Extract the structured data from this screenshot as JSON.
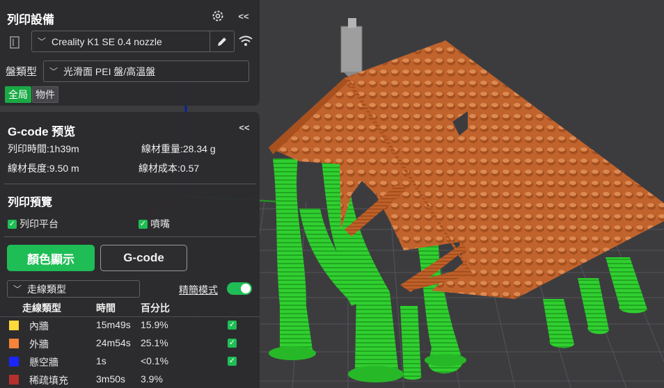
{
  "printer": {
    "title": "列印設備",
    "printer_name": "Creality K1 SE 0.4 nozzle",
    "plate_label": "盤類型",
    "plate_value": "光滑面 PEI 盤/高溫盤",
    "tabs": [
      "全局",
      "物件"
    ],
    "collapse_label": "<<"
  },
  "gcode": {
    "title": "G-code 预览",
    "collapse_label": "<<",
    "print_time": "列印時間:1h39m",
    "filament_weight": "線材重量:28.34 g",
    "filament_length": "線材長度:9.50 m",
    "filament_cost": "線材成本:0.57",
    "preview_title": "列印預覽",
    "show_bed": "列印平台",
    "show_nozzle": "噴嘴",
    "color_button": "顏色顯示",
    "gcode_button": "G-code",
    "line_type_select": "走線類型",
    "simple_mode": "精簡模式",
    "columns": [
      "走線類型",
      "時間",
      "百分比"
    ],
    "rows": [
      {
        "name": "內牆",
        "time": "15m49s",
        "percent": "15.9%",
        "color": "#ffd83a",
        "checked": true
      },
      {
        "name": "外牆",
        "time": "24m54s",
        "percent": "25.1%",
        "color": "#f7823a",
        "checked": true
      },
      {
        "name": "懸空牆",
        "time": "1s",
        "percent": "<0.1%",
        "color": "#1a25ff",
        "checked": true
      },
      {
        "name": "稀疏填充",
        "time": "3m50s",
        "percent": "3.9%",
        "color": "#b5302c",
        "checked": false
      }
    ]
  },
  "colors": {
    "accent": "#1fbd55",
    "support": "#2ed02e",
    "roof": "#c46a30"
  },
  "icons": {
    "settings": "gear-icon",
    "printer": "printer-icon",
    "edit": "pencil-icon",
    "wifi": "wifi-icon",
    "dropdown": "chevron-down-icon",
    "checkbox": "check-icon"
  }
}
